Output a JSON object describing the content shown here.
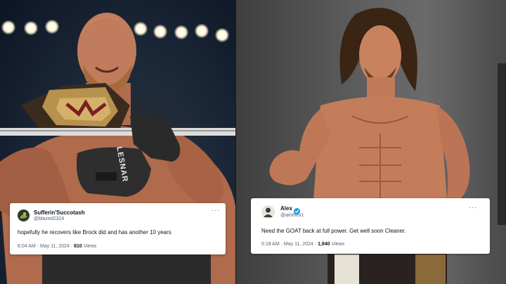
{
  "tweets": [
    {
      "display_name": "Sufferin'Succotash",
      "handle": "@blazed2324",
      "text": "hopefully he recovers like Brock did and has another 10 years",
      "time": "6:04 AM",
      "date": "May 11, 2024",
      "views_count": "810",
      "views_label": "Views",
      "verified": false
    },
    {
      "display_name": "Alex",
      "handle": "@ainthex1",
      "text": "Need the GOAT back at full power. Get well soon Cleaner.",
      "time": "5:18 AM",
      "date": "May 11, 2024",
      "views_count": "1,940",
      "views_label": "Views",
      "verified": true
    }
  ],
  "left_photo": {
    "glove_text": "LESNAR"
  },
  "colors": {
    "verified": "#1d9bf0",
    "meta_text": "#536471",
    "text": "#0f1419"
  }
}
